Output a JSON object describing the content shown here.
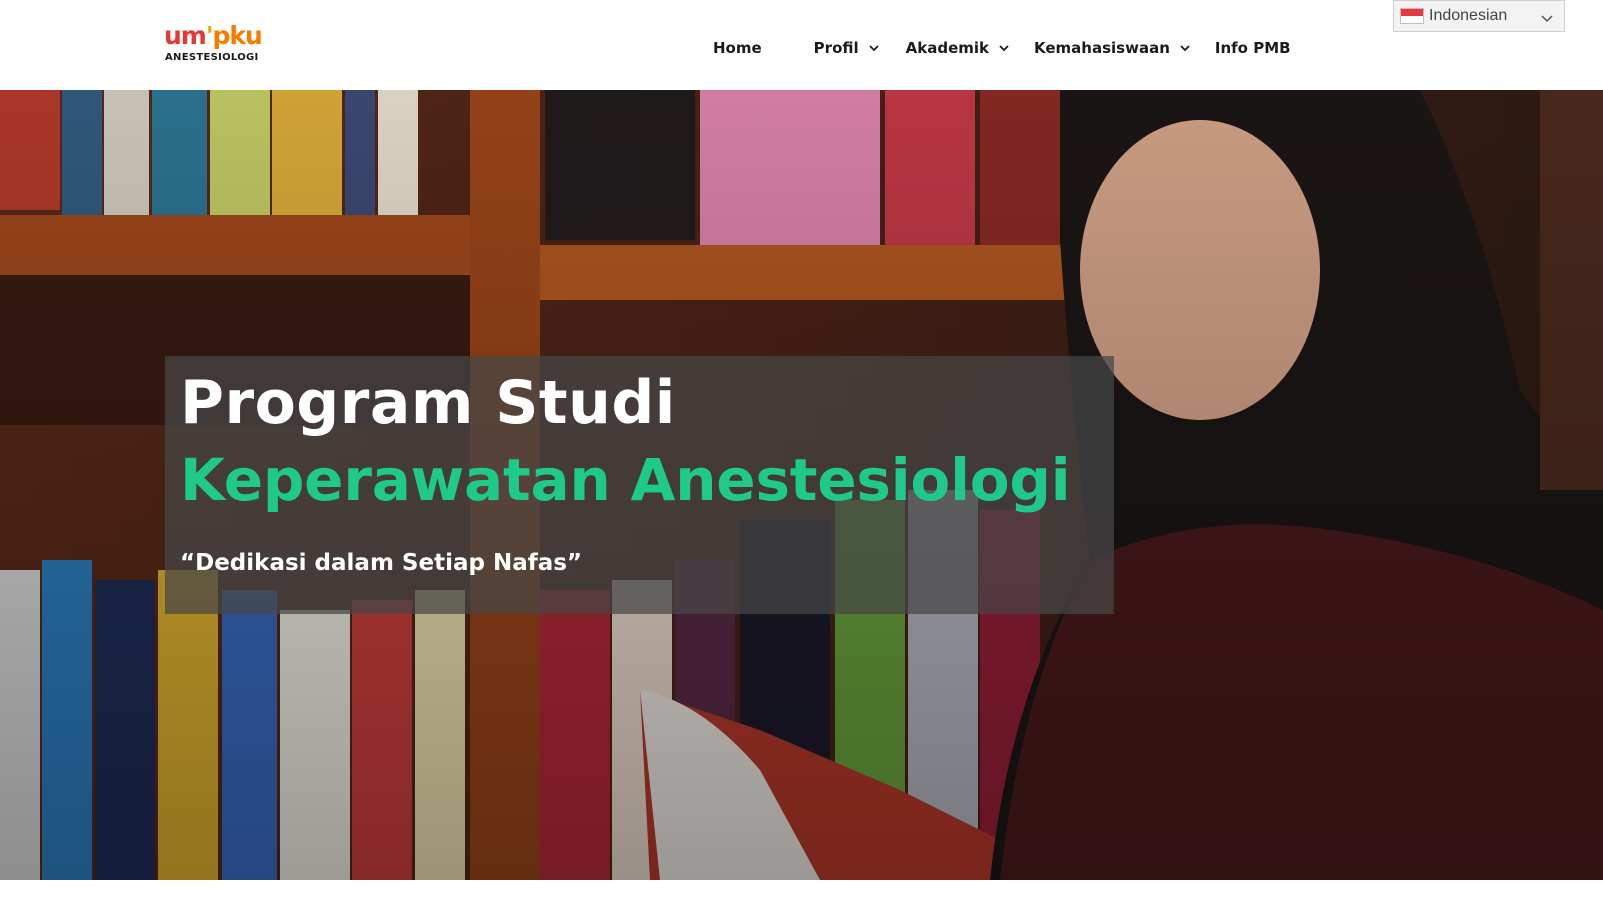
{
  "logo": {
    "part1": "um",
    "part2": "'",
    "part3": "pku",
    "subtitle": "ANESTESIOLOGI"
  },
  "nav": {
    "items": [
      {
        "label": "Home",
        "has_dropdown": false
      },
      {
        "label": "Profil",
        "has_dropdown": true
      },
      {
        "label": "Akademik",
        "has_dropdown": true
      },
      {
        "label": "Kemahasiswaan",
        "has_dropdown": true
      },
      {
        "label": "Info PMB",
        "has_dropdown": false
      }
    ]
  },
  "language": {
    "selected": "Indonesian",
    "flag": "indonesia-flag"
  },
  "hero": {
    "title_line1": "Program Studi",
    "title_line2": "Keperawatan Anestesiologi",
    "tagline": "“Dedikasi dalam Setiap Nafas”",
    "accent_color": "#1fc98a"
  }
}
